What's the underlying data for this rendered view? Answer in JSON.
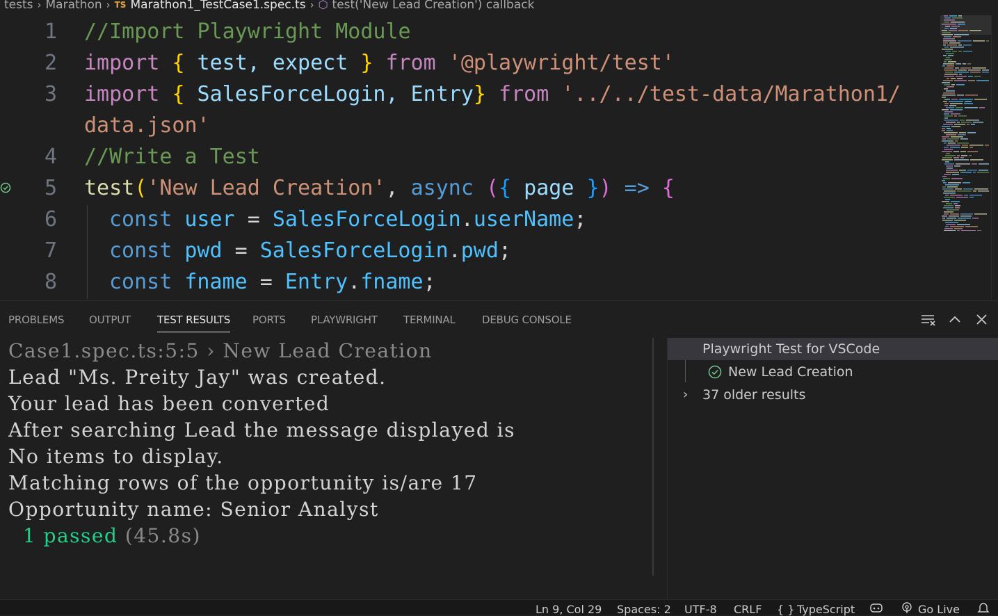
{
  "breadcrumb": {
    "items": [
      "tests",
      "Marathon"
    ],
    "file_badge": "TS",
    "file": "Marathon1_TestCase1.spec.ts",
    "symbol": "test('New Lead Creation') callback"
  },
  "editor": {
    "lines": [
      {
        "num": "1",
        "text": "//Import Playwright Module"
      },
      {
        "num": "2",
        "text": "import { test, expect } from '@playwright/test'"
      },
      {
        "num": "3",
        "text": "import { SalesForceLogin, Entry} from '../../test-data/Marathon1/"
      },
      {
        "num": "",
        "text": "data.json'"
      },
      {
        "num": "4",
        "text": "//Write a Test"
      },
      {
        "num": "5",
        "text": "test('New Lead Creation', async ({ page }) => {"
      },
      {
        "num": "6",
        "text": "  const user = SalesForceLogin.userName;"
      },
      {
        "num": "7",
        "text": "  const pwd = SalesForceLogin.pwd;"
      },
      {
        "num": "8",
        "text": "  const fname = Entry.fname;"
      }
    ],
    "tokens": {
      "l1": "//Import Playwright Module",
      "import": "import",
      "lb": "{",
      "rb": "}",
      "l2_ids": " test, expect ",
      "from": "from",
      "l2_str": "'@playwright/test'",
      "l3_ids": " SalesForceLogin, Entry",
      "l3_str": "'../../test-data/Marathon1/",
      "l3b_str": "data.json'",
      "l4": "//Write a Test",
      "test": "test",
      "lp": "(",
      "rp": ")",
      "l5_str": "'New Lead Creation'",
      "comma": ",",
      "async": "async",
      "page": "page",
      "arrow": "=>",
      "const": "const",
      "user": "user",
      "eq": "=",
      "sfl": "SalesForceLogin",
      "dot": ".",
      "userName": "userName",
      "semi": ";",
      "pwd": "pwd",
      "fname": "fname",
      "entry": "Entry"
    }
  },
  "panel": {
    "tabs": [
      "PROBLEMS",
      "OUTPUT",
      "TEST RESULTS",
      "PORTS",
      "PLAYWRIGHT",
      "TERMINAL",
      "DEBUG CONSOLE"
    ],
    "active_tab": "TEST RESULTS",
    "output": {
      "header": "Case1.spec.ts:5:5 › New Lead Creation",
      "lines": [
        "Lead \"Ms. Preity Jay\" was created.",
        "Your lead has been converted",
        "After searching Lead the message displayed is",
        "No items to display.",
        "Matching rows of the opportunity is/are 17",
        "Opportunity name: Senior Analyst"
      ],
      "summary_count": "1",
      "summary_word": "passed",
      "summary_time": "(45.8s)"
    },
    "results": {
      "root": "Playwright Test for VSCode",
      "child": "New Lead Creation",
      "older": "37 older results"
    }
  },
  "statusbar": {
    "position": "Ln 9, Col 29",
    "spaces": "Spaces: 2",
    "encoding": "UTF-8",
    "eol": "CRLF",
    "language": "TypeScript",
    "golive": "Go Live"
  },
  "colors": {
    "background": "#1f1f1f",
    "pass_green": "#23d18b",
    "selected_row": "#37373d"
  }
}
